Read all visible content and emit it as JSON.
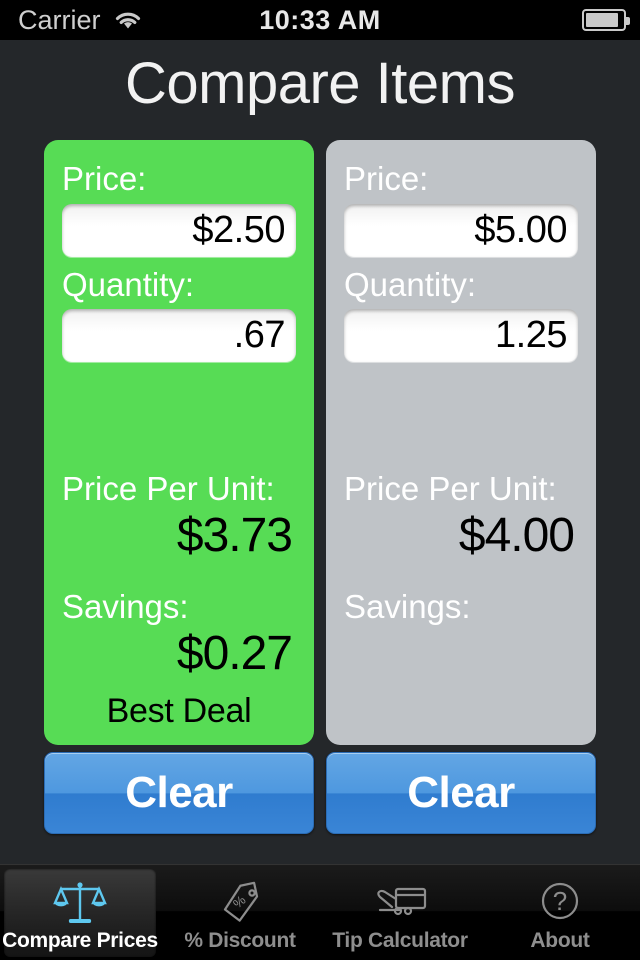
{
  "status_bar": {
    "carrier": "Carrier",
    "wifi_icon": "wifi-icon",
    "time": "10:33 AM",
    "battery_icon": "battery-icon"
  },
  "header": {
    "title": "Compare Items"
  },
  "colors": {
    "background": "#24272a",
    "best_deal_card": "#57dc55",
    "other_card": "#bfc3c7",
    "button_blue": "#4e98df",
    "title_text": "#f2f2f2"
  },
  "items": [
    {
      "id": "item-left",
      "is_best_deal": true,
      "price_label": "Price:",
      "price_value": "$2.50",
      "price_placeholder": "Price",
      "quantity_label": "Quantity:",
      "quantity_value": ".67",
      "quantity_placeholder": "Quantity",
      "price_per_unit_label": "Price Per Unit:",
      "price_per_unit_value": "$3.73",
      "savings_label": "Savings:",
      "savings_value": "$0.27",
      "best_deal_text": "Best Deal",
      "clear_label": "Clear"
    },
    {
      "id": "item-right",
      "is_best_deal": false,
      "price_label": "Price:",
      "price_value": "$5.00",
      "price_placeholder": "Price",
      "quantity_label": "Quantity:",
      "quantity_value": "1.25",
      "quantity_placeholder": "Quantity",
      "price_per_unit_label": "Price Per Unit:",
      "price_per_unit_value": "$4.00",
      "savings_label": "Savings:",
      "savings_value": "",
      "best_deal_text": "",
      "clear_label": "Clear"
    }
  ],
  "tabbar": {
    "active_index": 0,
    "tabs": [
      {
        "label": "Compare Prices",
        "icon": "balance-scales-icon"
      },
      {
        "label": "% Discount",
        "icon": "price-tag-icon"
      },
      {
        "label": "Tip Calculator",
        "icon": "credit-card-hand-icon"
      },
      {
        "label": "About",
        "icon": "question-mark-circle-icon"
      }
    ]
  }
}
